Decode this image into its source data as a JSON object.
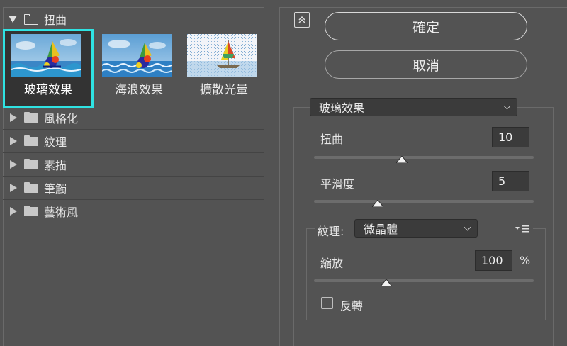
{
  "left_panel": {
    "open_folder": {
      "label": "扭曲",
      "icon": "folder-outline-icon"
    },
    "thumbnails": [
      {
        "label": "玻璃效果",
        "selected": true,
        "image": "glass-effect-thumbnail"
      },
      {
        "label": "海浪效果",
        "selected": false,
        "image": "ocean-ripple-thumbnail"
      },
      {
        "label": "擴散光暈",
        "selected": false,
        "image": "diffuse-glow-thumbnail"
      }
    ],
    "folders": [
      {
        "label": "風格化",
        "icon": "folder-icon"
      },
      {
        "label": "紋理",
        "icon": "folder-icon"
      },
      {
        "label": "素描",
        "icon": "folder-icon"
      },
      {
        "label": "筆觸",
        "icon": "folder-icon"
      },
      {
        "label": "藝術風",
        "icon": "folder-icon"
      }
    ],
    "selection_color": "#2fe3e3"
  },
  "right_panel": {
    "collapse_icon": "double-chevron-up-icon",
    "ok_label": "確定",
    "cancel_label": "取消",
    "filter_select": "玻璃效果",
    "params": {
      "distortion": {
        "label": "扭曲",
        "value": "10",
        "slider_fraction": 0.4
      },
      "smoothness": {
        "label": "平滑度",
        "value": "5",
        "slider_fraction": 0.29
      },
      "texture": {
        "label": "紋理:",
        "value": "微晶體",
        "menu_icon": "flyout-menu-icon"
      },
      "scaling": {
        "label": "縮放",
        "value": "100",
        "unit": "%",
        "slider_fraction": 0.33
      },
      "invert": {
        "label": "反轉",
        "checked": false
      }
    }
  }
}
